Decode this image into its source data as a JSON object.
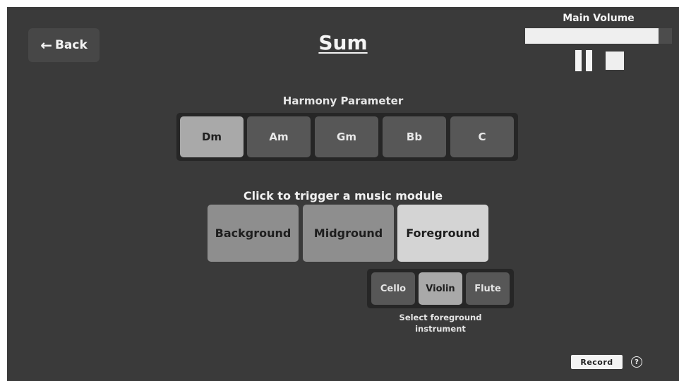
{
  "header": {
    "back_label": "Back",
    "back_icon": "arrow-left-icon",
    "title": "Sum"
  },
  "volume": {
    "label": "Main Volume",
    "level": 0.91,
    "pause_icon": "pause-icon",
    "stop_icon": "stop-icon"
  },
  "harmony": {
    "label": "Harmony Parameter",
    "chords": [
      "Dm",
      "Am",
      "Gm",
      "Bb",
      "C"
    ],
    "selected": "Dm"
  },
  "modules": {
    "label": "Click to trigger a music module",
    "items": [
      "Background",
      "Midground",
      "Foreground"
    ],
    "active": "Foreground"
  },
  "instruments": {
    "items": [
      "Cello",
      "Violin",
      "Flute"
    ],
    "selected": "Violin",
    "label": "Select foreground instrument"
  },
  "footer": {
    "record_label": "Record",
    "help_icon": "help-icon",
    "help_glyph": "?"
  },
  "colors": {
    "background": "#3a3a3a",
    "selected_button": "#a9a9a9",
    "button": "#575757",
    "group_bg": "#262626"
  }
}
